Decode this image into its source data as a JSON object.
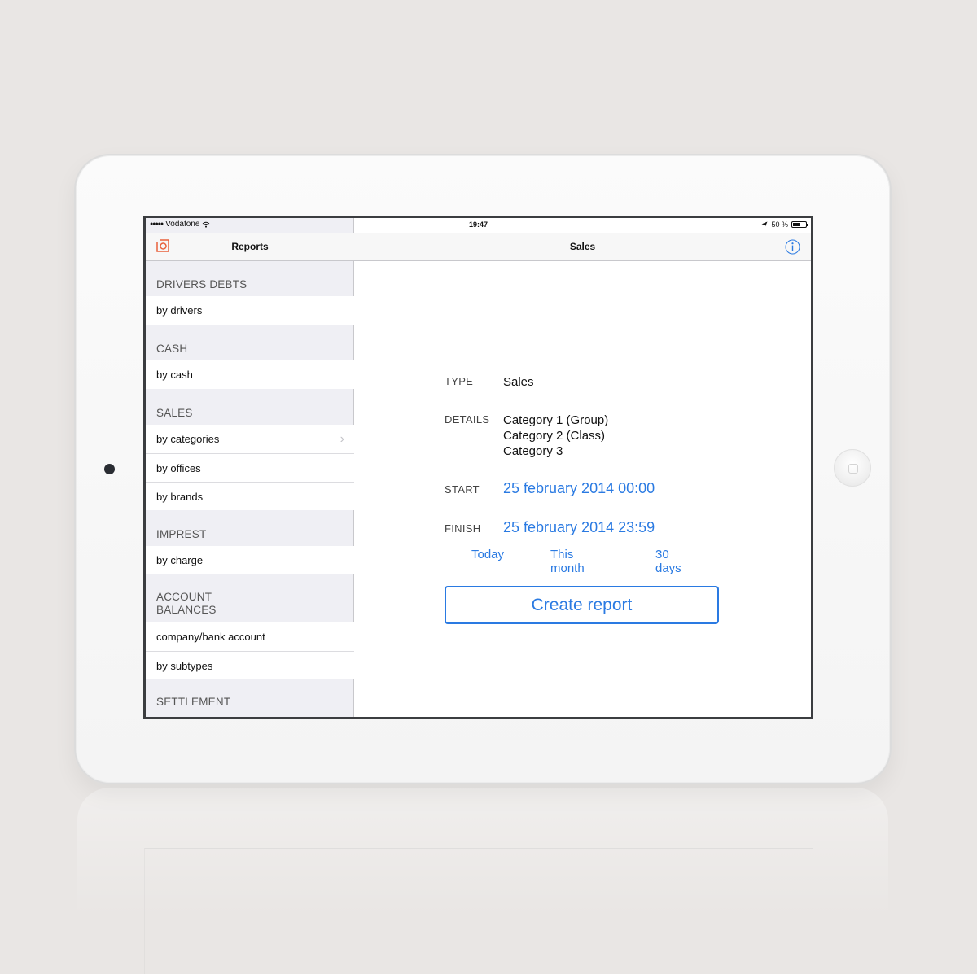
{
  "status_bar": {
    "carrier": "Vodafone",
    "time": "19:47",
    "battery": "50 %"
  },
  "left_nav": {
    "title": "Reports"
  },
  "right_nav": {
    "title": "Sales"
  },
  "sidebar": {
    "sections": [
      {
        "header": "DRIVERS DEBTS",
        "items": [
          "by drivers"
        ]
      },
      {
        "header": "CASH",
        "items": [
          "by cash"
        ]
      },
      {
        "header": "SALES",
        "items": [
          "by categories",
          "by offices",
          "by brands"
        ]
      },
      {
        "header": "IMPREST",
        "items": [
          "by charge"
        ]
      },
      {
        "header": "ACCOUNT BALANCES",
        "items": [
          "company/bank account",
          "by subtypes"
        ]
      },
      {
        "header": "SETTLEMENT",
        "items": []
      }
    ]
  },
  "form": {
    "type_label": "TYPE",
    "type_value": "Sales",
    "details_label": "DETAILS",
    "details_values": [
      "Category 1 (Group)",
      "Category 2 (Class)",
      "Category 3"
    ],
    "start_label": "START",
    "start_value": "25 february 2014 00:00",
    "finish_label": "FINISH",
    "finish_value": "25 february 2014 23:59",
    "shortcuts": [
      "Today",
      "This month",
      "30 days"
    ],
    "create_button": "Create report"
  },
  "colors": {
    "accent": "#2a7ae2",
    "app_icon": "#e8603c"
  },
  "icons": {
    "app": "app-logo-icon",
    "info": "info-icon",
    "chevron": "chevron-right-icon",
    "wifi": "wifi-icon",
    "location": "location-arrow-icon"
  }
}
